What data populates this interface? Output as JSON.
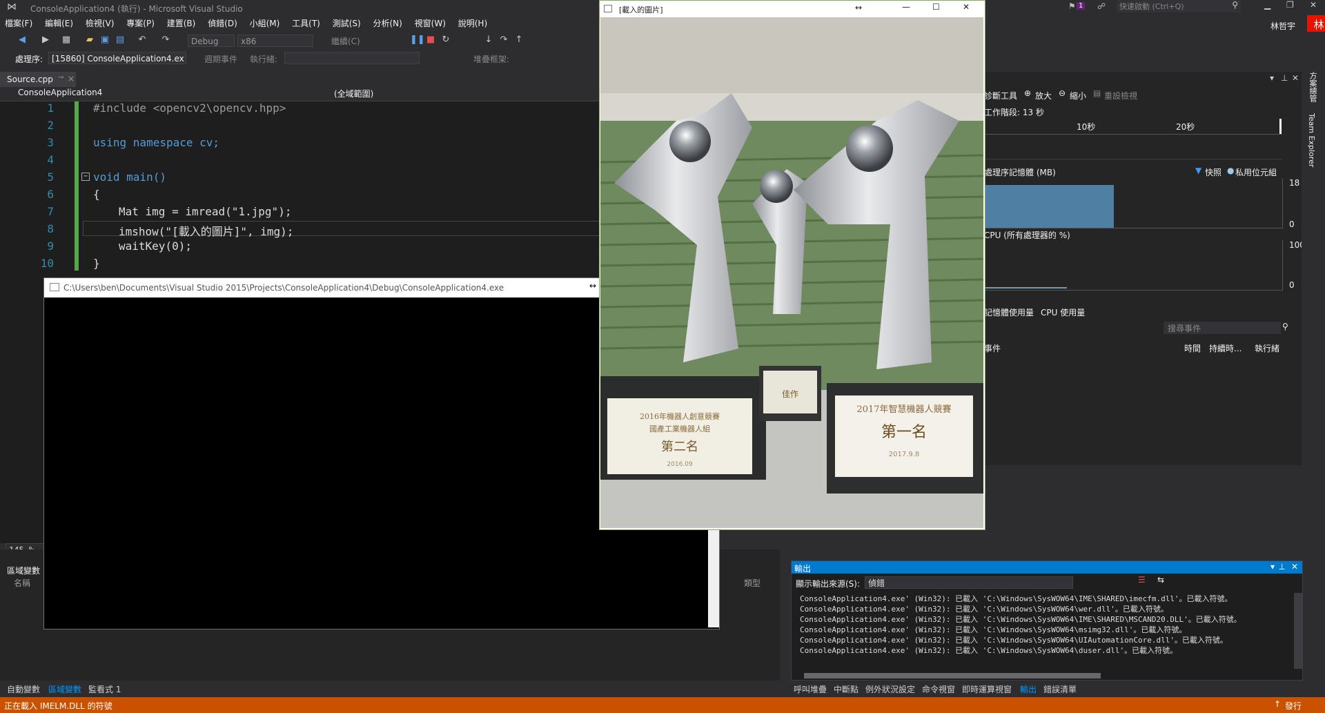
{
  "window": {
    "title": "ConsoleApplication4 (執行) - Microsoft Visual Studio",
    "quick_launch_placeholder": "快速啟動 (Ctrl+Q)",
    "user_name": "林哲宇",
    "avatar_letter": "林",
    "notification_count": "1"
  },
  "menu": [
    "檔案(F)",
    "編輯(E)",
    "檢視(V)",
    "專案(P)",
    "建置(B)",
    "偵錯(D)",
    "小組(M)",
    "工具(T)",
    "測試(S)",
    "分析(N)",
    "視窗(W)",
    "說明(H)"
  ],
  "toolbar": {
    "config": "Debug",
    "platform": "x86",
    "continue_label": "繼續(C)"
  },
  "debug_bar": {
    "process_label": "處理序:",
    "process_value": "[15860] ConsoleApplication4.ex",
    "lifecycle_label": "週期事件",
    "thread_label": "執行緒:",
    "stackframe_label": "堆疊框架:"
  },
  "editor": {
    "tab_label": "Source.cpp",
    "project_scope": "ConsoleApplication4",
    "global_scope": "(全域範圍)",
    "zoom": "145 %",
    "lines": [
      {
        "n": "1",
        "text": "#include <opencv2\\opencv.hpp>"
      },
      {
        "n": "2",
        "text": ""
      },
      {
        "n": "3",
        "text": "using namespace cv;"
      },
      {
        "n": "4",
        "text": ""
      },
      {
        "n": "5",
        "text": "void main()"
      },
      {
        "n": "6",
        "text": "{"
      },
      {
        "n": "7",
        "text": "Mat img = imread(\"1.jpg\");"
      },
      {
        "n": "8",
        "text": "imshow(\"[載入的圖片]\", img);"
      },
      {
        "n": "9",
        "text": "waitKey(0);"
      },
      {
        "n": "10",
        "text": "}"
      }
    ]
  },
  "console": {
    "title": "C:\\Users\\ben\\Documents\\Visual Studio 2015\\Projects\\ConsoleApplication4\\Debug\\ConsoleApplication4.exe"
  },
  "image_window": {
    "title": "[載入的圖片]",
    "plaque_left_line1": "2016年機器人創意競賽",
    "plaque_left_line2": "國產工業機器人組",
    "plaque_left_rank": "第二名",
    "plaque_left_date": "2016.09",
    "plaque_mid_rank": "佳作",
    "plaque_right_line1": "2017年智慧機器人競賽",
    "plaque_right_rank": "第一名",
    "plaque_right_date": "2017.9.8"
  },
  "diagnostics": {
    "tools_label": "診斷工具",
    "zoom_in": "放大",
    "zoom_out": "縮小",
    "reset_view": "重設檢視",
    "session_label": "工作階段: 13 秒",
    "time_ticks": [
      "10秒",
      "20秒"
    ],
    "memory_label": "處理序記憶體 (MB)",
    "snapshot_legend": "快照",
    "private_bytes_legend": "私用位元組",
    "memory_max": "18",
    "memory_min": "0",
    "cpu_label": "CPU (所有處理器的 %)",
    "cpu_max": "100",
    "cpu_min": "0",
    "tabs": [
      "記憶體使用量",
      "CPU 使用量"
    ],
    "search_placeholder": "搜尋事件",
    "columns": [
      "事件",
      "時間",
      "持續時...",
      "執行緒"
    ]
  },
  "right_strip": [
    "方案總管",
    "Team Explorer"
  ],
  "locals": {
    "title": "區域變數",
    "name_col": "名稱",
    "type_col": "類型"
  },
  "output": {
    "title": "輸出",
    "source_label": "顯示輸出來源(S):",
    "source_value": "偵錯",
    "lines": [
      "ConsoleApplication4.exe' (Win32): 已載入 'C:\\Windows\\SysWOW64\\IME\\SHARED\\imecfm.dll'。已載入符號。",
      "ConsoleApplication4.exe' (Win32): 已載入 'C:\\Windows\\SysWOW64\\wer.dll'。已載入符號。",
      "ConsoleApplication4.exe' (Win32): 已載入 'C:\\Windows\\SysWOW64\\IME\\SHARED\\MSCAND20.DLL'。已載入符號。",
      "ConsoleApplication4.exe' (Win32): 已載入 'C:\\Windows\\SysWOW64\\msimg32.dll'。已載入符號。",
      "ConsoleApplication4.exe' (Win32): 已載入 'C:\\Windows\\SysWOW64\\UIAutomationCore.dll'。已載入符號。",
      "ConsoleApplication4.exe' (Win32): 已載入 'C:\\Windows\\SysWOW64\\duser.dll'。已載入符號。"
    ]
  },
  "bottom_tabs_left": [
    "自動變數",
    "區域變數",
    "監看式 1"
  ],
  "bottom_tabs_right": [
    "呼叫堆疊",
    "中斷點",
    "例外狀況設定",
    "命令視窗",
    "即時運算視窗",
    "輸出",
    "錯誤清單"
  ],
  "status": {
    "message": "正在載入 IMELM.DLL 的符號",
    "publish": "發行"
  },
  "colors": {
    "accent": "#007acc",
    "status": "#ca5100",
    "brand": "#68217a"
  }
}
